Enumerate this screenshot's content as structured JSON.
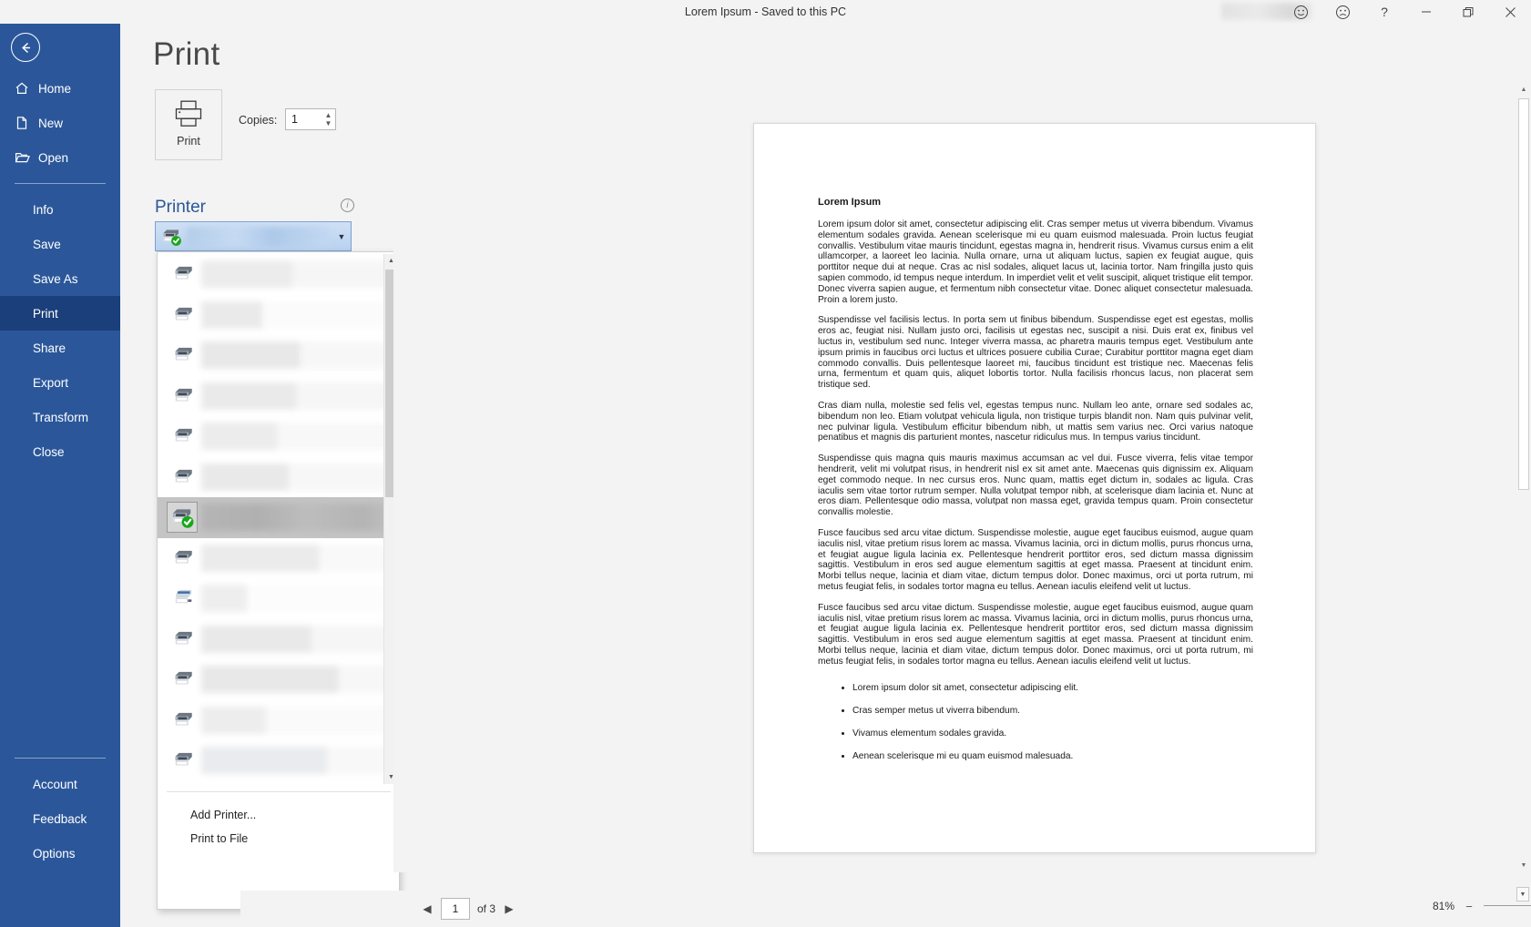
{
  "titlebar": {
    "title": "Lorem Ipsum  -  Saved to this PC",
    "buttons": [
      {
        "name": "smiley-icon",
        "label": "☺"
      },
      {
        "name": "frowny-icon",
        "label": "☹"
      },
      {
        "name": "help-icon",
        "label": "?"
      },
      {
        "name": "minimize-icon",
        "label": "—"
      },
      {
        "name": "restore-icon",
        "label": "❐"
      },
      {
        "name": "close-icon",
        "label": "✕"
      }
    ]
  },
  "leftnav": {
    "back_label": "Back",
    "top_items": [
      {
        "label": "Home",
        "icon": "home-icon"
      },
      {
        "label": "New",
        "icon": "new-document-icon"
      },
      {
        "label": "Open",
        "icon": "open-folder-icon"
      }
    ],
    "items": [
      {
        "label": "Info"
      },
      {
        "label": "Save"
      },
      {
        "label": "Save As"
      },
      {
        "label": "Print"
      },
      {
        "label": "Share"
      },
      {
        "label": "Export"
      },
      {
        "label": "Transform"
      },
      {
        "label": "Close"
      }
    ],
    "active": "Print",
    "bottom_items": [
      {
        "label": "Account"
      },
      {
        "label": "Feedback"
      },
      {
        "label": "Options"
      }
    ]
  },
  "print_pane": {
    "page_title": "Print",
    "print_button_label": "Print",
    "copies_label": "Copies:",
    "copies_value": "1",
    "spinner_up": "▲",
    "spinner_down": "▼",
    "printer_heading": "Printer",
    "printer_info_tooltip": "i",
    "selected_printer_name": "",
    "combo_caret": "▼"
  },
  "printer_dropdown": {
    "items": [
      {
        "name": "",
        "selected": false,
        "icon": "printer-icon"
      },
      {
        "name": "",
        "selected": false,
        "icon": "printer-icon"
      },
      {
        "name": "",
        "selected": false,
        "icon": "printer-icon"
      },
      {
        "name": "",
        "selected": false,
        "icon": "printer-icon"
      },
      {
        "name": "",
        "selected": false,
        "icon": "printer-icon"
      },
      {
        "name": "",
        "selected": false,
        "icon": "printer-icon"
      },
      {
        "name": "",
        "selected": true,
        "icon": "printer-icon-ready"
      },
      {
        "name": "",
        "selected": false,
        "icon": "printer-icon"
      },
      {
        "name": "",
        "selected": false,
        "icon": "fax-printer-icon"
      },
      {
        "name": "",
        "selected": false,
        "icon": "printer-icon"
      },
      {
        "name": "",
        "selected": false,
        "icon": "printer-icon"
      },
      {
        "name": "",
        "selected": false,
        "icon": "printer-icon"
      },
      {
        "name": "",
        "selected": false,
        "icon": "printer-icon"
      }
    ],
    "add_printer_label": "Add Printer...",
    "print_to_file_label": "Print to File",
    "scroll_up": "▲",
    "scroll_down": "▼"
  },
  "document": {
    "title": "Lorem Ipsum",
    "paragraphs": [
      "Lorem ipsum dolor sit amet, consectetur adipiscing elit. Cras semper metus ut viverra bibendum. Vivamus elementum sodales gravida. Aenean scelerisque mi eu quam euismod malesuada. Proin luctus feugiat convallis. Vestibulum vitae mauris tincidunt, egestas magna in, hendrerit risus. Vivamus cursus enim a elit ullamcorper, a laoreet leo lacinia. Nulla ornare, urna ut aliquam luctus, sapien ex feugiat augue, quis porttitor neque dui at neque. Cras ac nisl sodales, aliquet lacus ut, lacinia tortor. Nam fringilla justo quis sapien commodo, id tempus neque interdum. In imperdiet velit et velit suscipit, aliquet tristique elit tempor. Donec viverra sapien augue, et fermentum nibh consectetur vitae. Donec aliquet consectetur malesuada. Proin a lorem justo.",
      "Suspendisse vel facilisis lectus. In porta sem ut finibus bibendum. Suspendisse eget est egestas, mollis eros ac, feugiat nisi. Nullam justo orci, facilisis ut egestas nec, suscipit a nisi. Duis erat ex, finibus vel luctus in, vestibulum sed nunc. Integer viverra massa, ac pharetra mauris tempus eget. Vestibulum ante ipsum primis in faucibus orci luctus et ultrices posuere cubilia Curae; Curabitur porttitor magna eget diam commodo convallis. Duis pellentesque laoreet mi, faucibus tincidunt est tristique nec. Maecenas felis urna, fermentum et quam quis, aliquet lobortis tortor. Nulla facilisis rhoncus lacus, non placerat sem tristique sed.",
      "Cras diam nulla, molestie sed felis vel, egestas tempus nunc. Nullam leo ante, ornare sed sodales ac, bibendum non leo. Etiam volutpat vehicula ligula, non tristique turpis blandit non. Nam quis pulvinar velit, nec pulvinar ligula. Vestibulum efficitur bibendum nibh, ut mattis sem varius nec. Orci varius natoque penatibus et magnis dis parturient montes, nascetur ridiculus mus. In tempus varius tincidunt.",
      "Suspendisse quis magna quis mauris maximus accumsan ac vel dui. Fusce viverra, felis vitae tempor hendrerit, velit mi volutpat risus, in hendrerit nisl ex sit amet ante. Maecenas quis dignissim ex. Aliquam eget commodo neque. In nec cursus eros. Nunc quam, mattis eget dictum in, sodales ac ligula. Cras iaculis sem vitae tortor rutrum semper. Nulla volutpat tempor nibh, at scelerisque diam lacinia et. Nunc at eros diam. Pellentesque odio massa, volutpat non massa eget, gravida tempus quam. Proin consectetur convallis molestie.",
      "Fusce faucibus sed arcu vitae dictum. Suspendisse molestie, augue eget faucibus euismod, augue quam iaculis nisl, vitae pretium risus lorem ac massa. Vivamus lacinia, orci in dictum mollis, purus rhoncus urna, et feugiat augue ligula lacinia ex. Pellentesque hendrerit porttitor eros, sed dictum massa dignissim sagittis. Vestibulum in eros sed augue elementum sagittis at eget massa. Praesent at tincidunt enim. Morbi tellus neque, lacinia et diam vitae, dictum tempus dolor. Donec maximus, orci ut porta rutrum, mi metus feugiat felis, in sodales tortor magna eu tellus. Aenean iaculis eleifend velit ut luctus.",
      "Fusce faucibus sed arcu vitae dictum. Suspendisse molestie, augue eget faucibus euismod, augue quam iaculis nisl, vitae pretium risus lorem ac massa. Vivamus lacinia, orci in dictum mollis, purus rhoncus urna, et feugiat augue ligula lacinia ex. Pellentesque hendrerit porttitor eros, sed dictum massa dignissim sagittis. Vestibulum in eros sed augue elementum sagittis at eget massa. Praesent at tincidunt enim. Morbi tellus neque, lacinia et diam vitae, dictum tempus dolor. Donec maximus, orci ut porta rutrum, mi metus feugiat felis, in sodales tortor magna eu tellus. Aenean iaculis eleifend velit ut luctus."
    ],
    "bullets": [
      "Lorem ipsum dolor sit amet, consectetur adipiscing elit.",
      "Cras semper metus ut viverra bibendum.",
      "Vivamus elementum sodales gravida.",
      "Aenean scelerisque mi eu quam euismod malesuada."
    ]
  },
  "statusbar": {
    "prev_arrow": "◀",
    "next_arrow": "▶",
    "page_number": "1",
    "page_of": "of 3",
    "zoom_percent": "81%",
    "zoom_out": "−",
    "zoom_in": "+",
    "zoom_to_page": "zoom-to-page-icon"
  },
  "colors": {
    "accent": "#2b579a",
    "accent_active": "#1a3f7a",
    "chrome": "#f3f3f3",
    "heading": "#2b579a"
  }
}
